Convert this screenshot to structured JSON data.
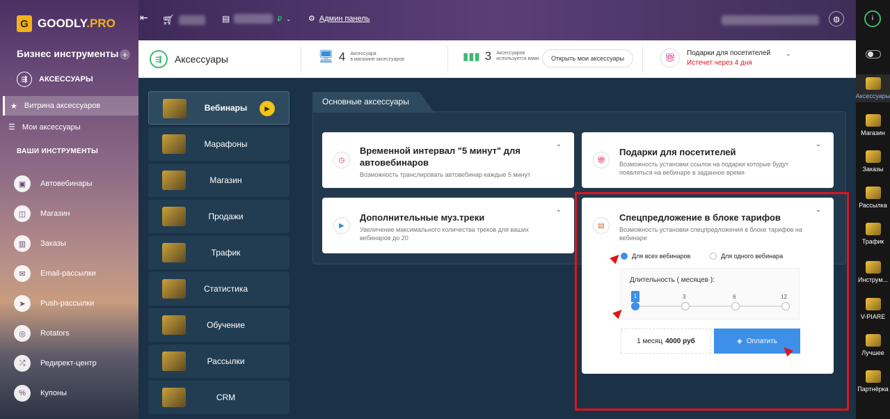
{
  "brand": {
    "logo_letter": "G",
    "name_part1": "GOODLY",
    "name_part2": ".PRO"
  },
  "sidebar": {
    "title": "Бизнес инструменты",
    "plus": "+",
    "section": "АКСЕССУАРЫ",
    "active_item": "Витрина аксессуаров",
    "my_item": "Мои аксессуары",
    "tools_heading": "ВАШИ ИНСТРУМЕНТЫ",
    "tools": [
      "Автовебинары",
      "Магазин",
      "Заказы",
      "Email-рассылки",
      "Push-рассылки",
      "Rotators",
      "Редирект-центр",
      "Купоны"
    ]
  },
  "topbar": {
    "admin_label": "Админ панель",
    "currency": "₽"
  },
  "inforow": {
    "page_title": "Аксессуары",
    "stat1_num": "4",
    "stat1_line1": "Аксессуара",
    "stat1_line2": "в магазине аксессуаров",
    "stat2_num": "3",
    "stat2_line1": "Аксессуаров",
    "stat2_line2": "используется вами",
    "my_button": "Открыть мои аксессуары",
    "gift_title": "Подарки для посетителей",
    "gift_expire": "Истечет через 4 дня"
  },
  "categories": [
    "Вебинары",
    "Марафоны",
    "Магазин",
    "Продажи",
    "Трафик",
    "Статистика",
    "Обучение",
    "Рассылки",
    "CRM"
  ],
  "tab_title": "Основные аксессуары",
  "cards": [
    {
      "title": "Временной интервал \"5 минут\" для автовебинаров",
      "desc": "Возможность транслировать автовебинар каждые 5 минут"
    },
    {
      "title": "Подарки для посетителей",
      "desc": "Возможность установки ссылок на подарки которые будут появляться на вебинаре в заданное время"
    },
    {
      "title": "Дополнительные муз.треки",
      "desc": "Увеличение максимального количества треков для ваших вебинаров до 20"
    },
    {
      "title": "Спецпредложение в блоке тарифов",
      "desc": "Возможность установки спецпредложения в блоке тарифов на вебинаре"
    }
  ],
  "offer": {
    "radio_all": "Для всех вебинаров",
    "radio_one": "Для одного вебинара",
    "duration_label": "Длительность ( месяцев ):",
    "stops": [
      "1",
      "3",
      "6",
      "12"
    ],
    "selected_months": "1",
    "price_prefix": "1 месяц",
    "price_value": "4000 руб",
    "pay_label": "Оплатить"
  },
  "rail": [
    "Аксессуары",
    "Магазин",
    "Заказы",
    "Рассылка",
    "Трафик",
    "Инструм...",
    "V-PIARE",
    "Лучшее",
    "Партнёрка"
  ],
  "colors": {
    "accent": "#3d8fe8",
    "highlight": "#e0141b",
    "brand": "#f2b21b",
    "success": "#3eb872"
  }
}
